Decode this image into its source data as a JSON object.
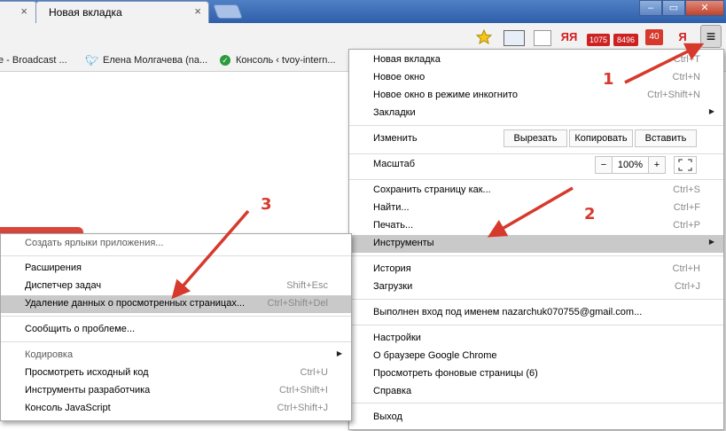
{
  "browser": {
    "tab_title": "Новая вкладка",
    "tab_close": "×",
    "win_min": "–",
    "win_max": "▭",
    "win_close": "✕"
  },
  "toolbar": {
    "ext1": "1075",
    "ext2": "8496",
    "ext3": "40",
    "ya1": "ЯЯ",
    "ya2": "Я",
    "menu_icon": "≡"
  },
  "bookmarks": [
    {
      "label": "e - Broadcast ..."
    },
    {
      "label": "Елена Молгачева (na..."
    },
    {
      "label": "Консоль ‹ tvoy-intern..."
    }
  ],
  "main_menu": {
    "new_tab": {
      "label": "Новая вкладка",
      "shortcut": "Ctrl+T"
    },
    "new_window": {
      "label": "Новое окно",
      "shortcut": "Ctrl+N"
    },
    "incognito": {
      "label": "Новое окно в режиме инкогнито",
      "shortcut": "Ctrl+Shift+N"
    },
    "bookmarks": {
      "label": "Закладки"
    },
    "edit": {
      "label": "Изменить",
      "cut": "Вырезать",
      "copy": "Копировать",
      "paste": "Вставить"
    },
    "zoom": {
      "label": "Масштаб",
      "minus": "−",
      "value": "100%",
      "plus": "+"
    },
    "save_page": {
      "label": "Сохранить страницу как...",
      "shortcut": "Ctrl+S"
    },
    "find": {
      "label": "Найти...",
      "shortcut": "Ctrl+F"
    },
    "print": {
      "label": "Печать...",
      "shortcut": "Ctrl+P"
    },
    "tools": {
      "label": "Инструменты"
    },
    "history": {
      "label": "История",
      "shortcut": "Ctrl+H"
    },
    "downloads": {
      "label": "Загрузки",
      "shortcut": "Ctrl+J"
    },
    "signed_in": {
      "label": "Выполнен вход под именем nazarchuk070755@gmail.com..."
    },
    "settings": {
      "label": "Настройки"
    },
    "about": {
      "label": "О браузере Google Chrome"
    },
    "background": {
      "label": "Просмотреть фоновые страницы (6)"
    },
    "help": {
      "label": "Справка"
    },
    "exit": {
      "label": "Выход"
    }
  },
  "tools_menu": {
    "create_shortcuts": {
      "label": "Создать ярлыки приложения..."
    },
    "extensions": {
      "label": "Расширения"
    },
    "task_manager": {
      "label": "Диспетчер задач",
      "shortcut": "Shift+Esc"
    },
    "clear_data": {
      "label": "Удаление данных о просмотренных страницах...",
      "shortcut": "Ctrl+Shift+Del"
    },
    "report_issue": {
      "label": "Сообщить о проблеме..."
    },
    "encoding": {
      "label": "Кодировка"
    },
    "view_source": {
      "label": "Просмотреть исходный код",
      "shortcut": "Ctrl+U"
    },
    "dev_tools": {
      "label": "Инструменты разработчика",
      "shortcut": "Ctrl+Shift+I"
    },
    "js_console": {
      "label": "Консоль JavaScript",
      "shortcut": "Ctrl+Shift+J"
    }
  },
  "annotations": {
    "n1": "1",
    "n2": "2",
    "n3": "3"
  },
  "colors": {
    "annotation": "#d63a2c",
    "titlebar": "#3a6cb8",
    "highlight": "#c9c9c9"
  }
}
